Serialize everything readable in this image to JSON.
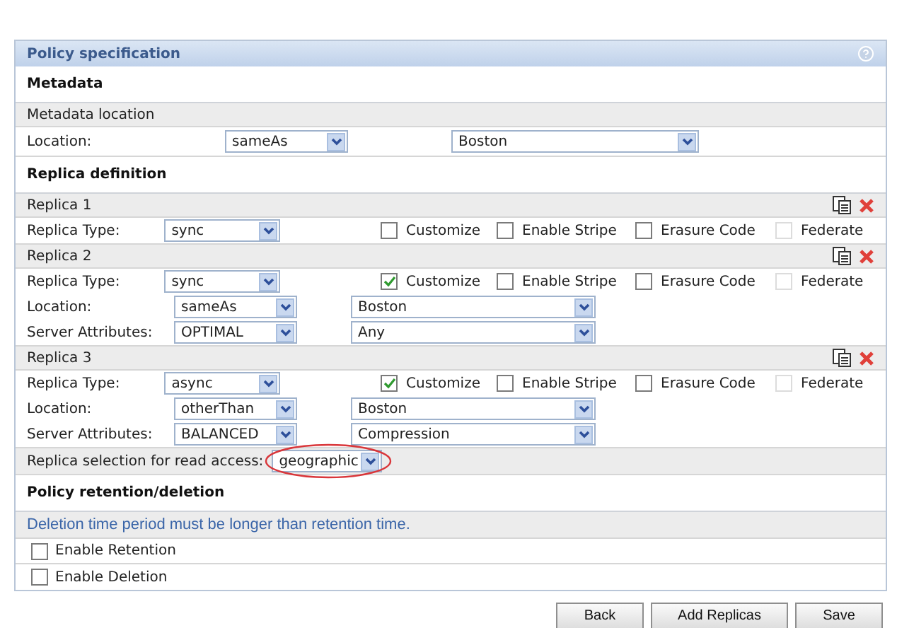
{
  "panel": {
    "title": "Policy specification"
  },
  "metadata": {
    "heading": "Metadata",
    "subheading": "Metadata location",
    "location": {
      "label": "Location:",
      "operator": "sameAs",
      "value": "Boston"
    }
  },
  "replica_definition": {
    "heading": "Replica definition",
    "replicas": [
      {
        "title": "Replica 1",
        "type_label": "Replica Type:",
        "type": "sync",
        "options": [
          {
            "label": "Customize",
            "checked": false,
            "disabled": false
          },
          {
            "label": "Enable Stripe",
            "checked": false,
            "disabled": false
          },
          {
            "label": "Erasure Code",
            "checked": false,
            "disabled": false
          },
          {
            "label": "Federate",
            "checked": false,
            "disabled": true
          }
        ]
      },
      {
        "title": "Replica 2",
        "type_label": "Replica Type:",
        "type": "sync",
        "options": [
          {
            "label": "Customize",
            "checked": true,
            "disabled": false
          },
          {
            "label": "Enable Stripe",
            "checked": false,
            "disabled": false
          },
          {
            "label": "Erasure Code",
            "checked": false,
            "disabled": false
          },
          {
            "label": "Federate",
            "checked": false,
            "disabled": true
          }
        ],
        "fields": [
          {
            "label": "Location:",
            "operator": "sameAs",
            "value": "Boston"
          },
          {
            "label": "Server Attributes:",
            "operator": "OPTIMAL",
            "value": "Any"
          }
        ]
      },
      {
        "title": "Replica 3",
        "type_label": "Replica Type:",
        "type": "async",
        "options": [
          {
            "label": "Customize",
            "checked": true,
            "disabled": false
          },
          {
            "label": "Enable Stripe",
            "checked": false,
            "disabled": false
          },
          {
            "label": "Erasure Code",
            "checked": false,
            "disabled": false
          },
          {
            "label": "Federate",
            "checked": false,
            "disabled": true
          }
        ],
        "fields": [
          {
            "label": "Location:",
            "operator": "otherThan",
            "value": "Boston"
          },
          {
            "label": "Server Attributes:",
            "operator": "BALANCED",
            "value": "Compression"
          }
        ]
      }
    ],
    "read_selection": {
      "label": "Replica selection for read access:",
      "value": "geographic",
      "highlighted": true
    }
  },
  "retention": {
    "heading": "Policy retention/deletion",
    "message": "Deletion time period must be longer than retention time.",
    "options": [
      {
        "label": "Enable Retention",
        "checked": false
      },
      {
        "label": "Enable Deletion",
        "checked": false
      }
    ]
  },
  "buttons": [
    "Back",
    "Add Replicas",
    "Save"
  ]
}
